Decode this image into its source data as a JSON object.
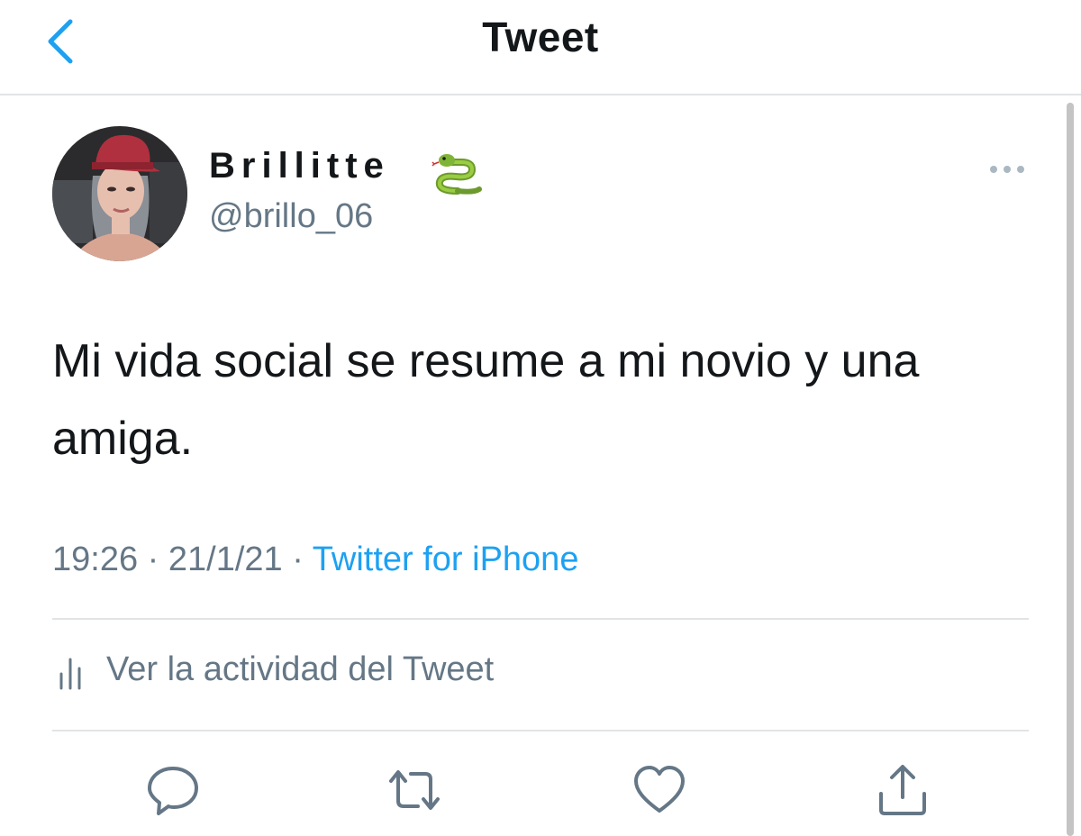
{
  "header": {
    "back_icon": "chevron-left-icon",
    "title": "Tweet"
  },
  "tweet": {
    "author": {
      "display_name": "Brillitte",
      "name_emoji": "snake-emoji-icon",
      "handle": "@brillo_06"
    },
    "text": "Mi vida social se resume a mi novio y una amiga.",
    "time": "19:26",
    "date": "21/1/21",
    "separator": "·",
    "source": "Twitter for iPhone",
    "activity_label": "Ver la actividad del Tweet"
  },
  "actions": [
    "reply-icon",
    "retweet-icon",
    "like-icon",
    "share-icon"
  ],
  "colors": {
    "accent": "#1da1f2",
    "text": "#14171a",
    "secondary": "#657786",
    "divider": "#e1e4e6"
  }
}
